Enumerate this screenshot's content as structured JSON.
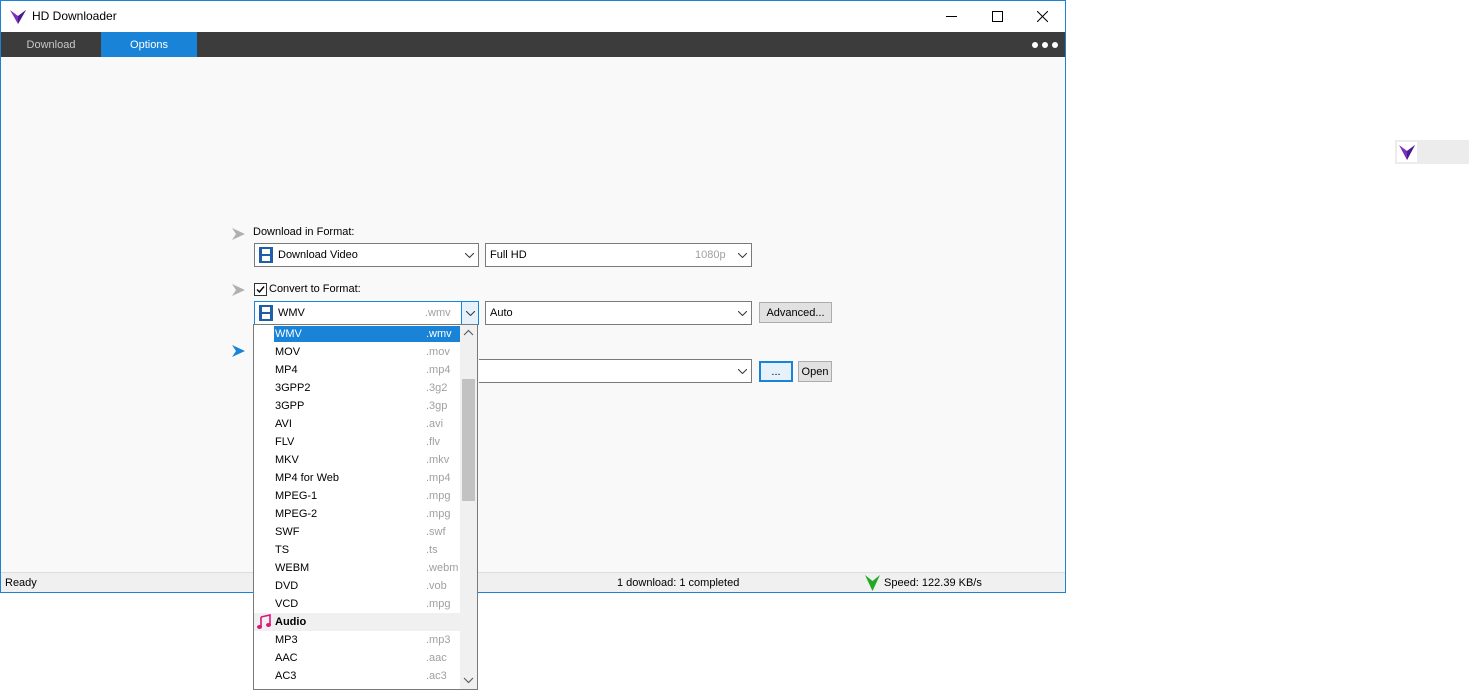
{
  "window": {
    "title": "HD Downloader"
  },
  "tabs": {
    "download": "Download",
    "options": "Options"
  },
  "format": {
    "label": "Download in Format:",
    "type_value": "Download Video",
    "quality_value": "Full HD",
    "quality_hint": "1080p"
  },
  "convert": {
    "checked": true,
    "label": "Convert to Format:",
    "format_value": "WMV",
    "format_ext": ".wmv",
    "audio_value": "Auto",
    "advanced_label": "Advanced..."
  },
  "output": {
    "browse_label": "...",
    "open_label": "Open"
  },
  "dropdown": {
    "items": [
      {
        "name": "WMV",
        "ext": ".wmv"
      },
      {
        "name": "MOV",
        "ext": ".mov"
      },
      {
        "name": "MP4",
        "ext": ".mp4"
      },
      {
        "name": "3GPP2",
        "ext": ".3g2"
      },
      {
        "name": "3GPP",
        "ext": ".3gp"
      },
      {
        "name": "AVI",
        "ext": ".avi"
      },
      {
        "name": "FLV",
        "ext": ".flv"
      },
      {
        "name": "MKV",
        "ext": ".mkv"
      },
      {
        "name": "MP4 for Web",
        "ext": ".mp4"
      },
      {
        "name": "MPEG-1",
        "ext": ".mpg"
      },
      {
        "name": "MPEG-2",
        "ext": ".mpg"
      },
      {
        "name": "SWF",
        "ext": ".swf"
      },
      {
        "name": "TS",
        "ext": ".ts"
      },
      {
        "name": "WEBM",
        "ext": ".webm"
      },
      {
        "name": "DVD",
        "ext": ".vob"
      },
      {
        "name": "VCD",
        "ext": ".mpg"
      }
    ],
    "audio_group": "Audio",
    "audio_items": [
      {
        "name": "MP3",
        "ext": ".mp3"
      },
      {
        "name": "AAC",
        "ext": ".aac"
      },
      {
        "name": "AC3",
        "ext": ".ac3"
      }
    ]
  },
  "status": {
    "ready": "Ready",
    "downloads": "1 download: 1 completed",
    "speed": "Speed: 122.39 KB/s"
  },
  "colors": {
    "accent": "#1883d7",
    "menubar": "#3c3c3c",
    "logo_purple": "#7b2fbe",
    "speed_green": "#22aa22",
    "audio_pink": "#e0147a"
  }
}
